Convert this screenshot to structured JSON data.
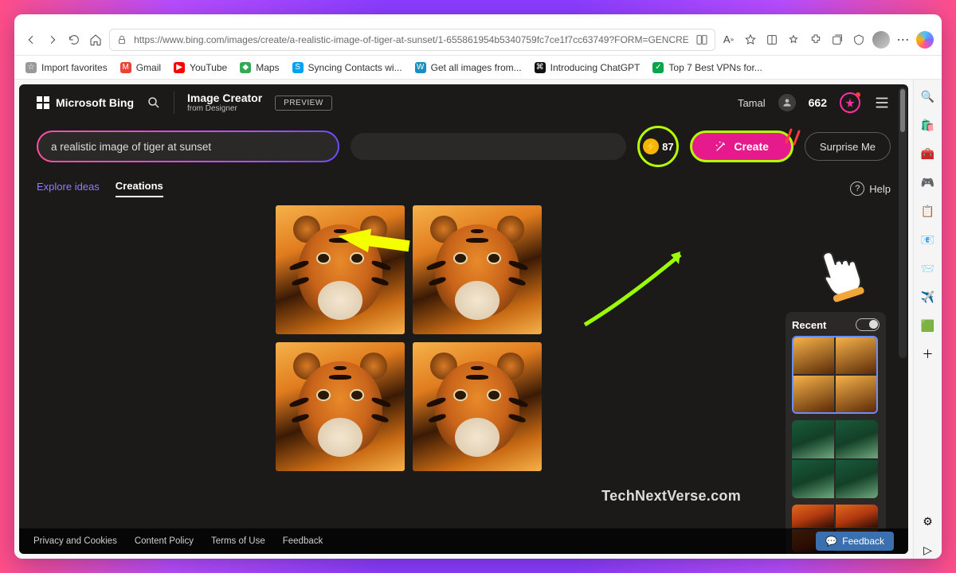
{
  "browser": {
    "url": "https://www.bing.com/images/create/a-realistic-image-of-tiger-at-sunset/1-655861954b5340759fc7ce1f7cc63749?FORM=GENCRE",
    "bookmarks": [
      {
        "label": "Import favorites",
        "color": "#777"
      },
      {
        "label": "Gmail",
        "color": "#ea4335"
      },
      {
        "label": "YouTube",
        "color": "#ff0000"
      },
      {
        "label": "Maps",
        "color": "#34a853"
      },
      {
        "label": "Syncing Contacts wi...",
        "color": "#00a1f1"
      },
      {
        "label": "Get all images from...",
        "color": "#1e8cbe"
      },
      {
        "label": "Introducing ChatGPT",
        "color": "#000"
      },
      {
        "label": "Top 7 Best VPNs for...",
        "color": "#0aa54a"
      }
    ]
  },
  "header": {
    "brand": "Microsoft Bing",
    "app": "Image Creator",
    "sub": "from Designer",
    "preview": "PREVIEW",
    "user": "Tamal",
    "credits": "662"
  },
  "prompt": {
    "value": "a realistic image of tiger at sunset",
    "boosts": "87",
    "create": "Create",
    "surprise": "Surprise Me"
  },
  "tabs": {
    "explore": "Explore ideas",
    "creations": "Creations",
    "help": "Help"
  },
  "recent": {
    "title": "Recent"
  },
  "watermark": "TechNextVerse.com",
  "footer": {
    "privacy": "Privacy and Cookies",
    "content": "Content Policy",
    "terms": "Terms of Use",
    "feedback": "Feedback",
    "feedback_pill": "Feedback"
  }
}
